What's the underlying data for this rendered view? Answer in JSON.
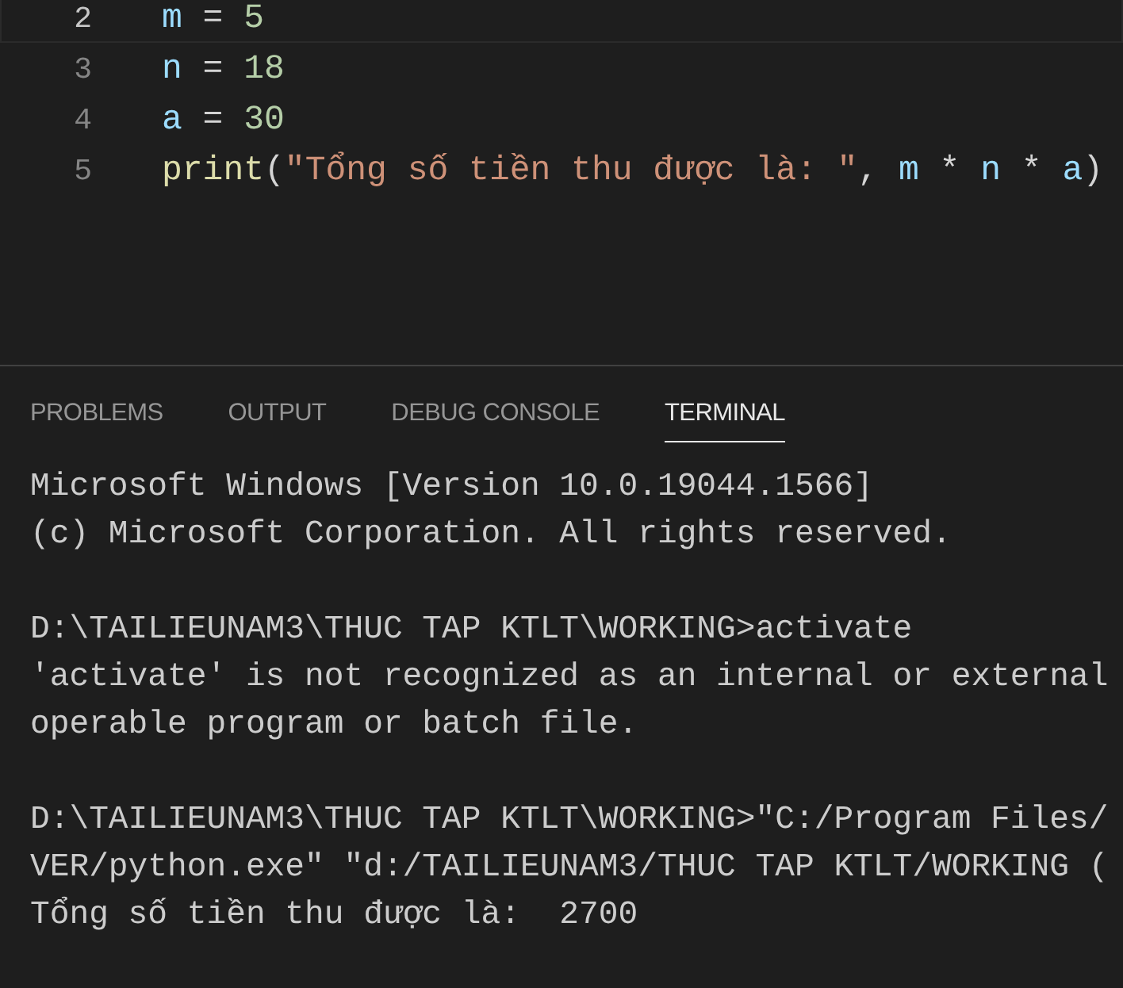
{
  "editor": {
    "lines": [
      {
        "number": "2",
        "current": true,
        "tokens": [
          {
            "text": "m",
            "kind": "variable"
          },
          {
            "text": " = ",
            "kind": "operator"
          },
          {
            "text": "5",
            "kind": "number"
          }
        ]
      },
      {
        "number": "3",
        "current": false,
        "tokens": [
          {
            "text": "n",
            "kind": "variable"
          },
          {
            "text": " = ",
            "kind": "operator"
          },
          {
            "text": "18",
            "kind": "number"
          }
        ]
      },
      {
        "number": "4",
        "current": false,
        "tokens": [
          {
            "text": "a",
            "kind": "variable"
          },
          {
            "text": " = ",
            "kind": "operator"
          },
          {
            "text": "30",
            "kind": "number"
          }
        ]
      },
      {
        "number": "5",
        "current": false,
        "tokens": [
          {
            "text": "print",
            "kind": "function"
          },
          {
            "text": "(",
            "kind": "operator"
          },
          {
            "text": "\"Tổng số tiền thu được là: \"",
            "kind": "string"
          },
          {
            "text": ", ",
            "kind": "operator"
          },
          {
            "text": "m",
            "kind": "variable"
          },
          {
            "text": " * ",
            "kind": "operator"
          },
          {
            "text": "n",
            "kind": "variable"
          },
          {
            "text": " * ",
            "kind": "operator"
          },
          {
            "text": "a",
            "kind": "variable"
          },
          {
            "text": ")",
            "kind": "operator"
          }
        ]
      }
    ]
  },
  "panel": {
    "tabs": [
      {
        "label": "PROBLEMS",
        "selected": false
      },
      {
        "label": "OUTPUT",
        "selected": false
      },
      {
        "label": "DEBUG CONSOLE",
        "selected": false
      },
      {
        "label": "TERMINAL",
        "selected": true
      }
    ],
    "terminal": {
      "blocks": [
        [
          "Microsoft Windows [Version 10.0.19044.1566]",
          "(c) Microsoft Corporation. All rights reserved."
        ],
        [
          "D:\\TAILIEUNAM3\\THUC TAP KTLT\\WORKING>activate",
          "'activate' is not recognized as an internal or external",
          "operable program or batch file."
        ],
        [
          "D:\\TAILIEUNAM3\\THUC TAP KTLT\\WORKING>\"C:/Program Files/",
          "VER/python.exe\" \"d:/TAILIEUNAM3/THUC TAP KTLT/WORKING (",
          "Tổng số tiền thu được là:  2700"
        ]
      ]
    }
  }
}
